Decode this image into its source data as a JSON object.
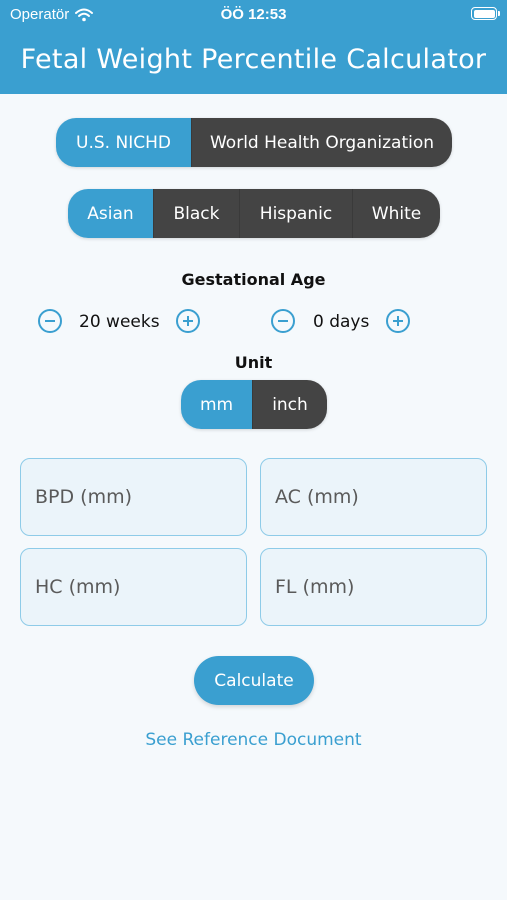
{
  "status_bar": {
    "carrier": "Operatör",
    "time": "ÖÖ 12:53",
    "wifi_icon": "wifi-icon",
    "battery_icon": "battery-icon"
  },
  "header": {
    "title": "Fetal Weight Percentile Calculator"
  },
  "standard": {
    "options": [
      "U.S. NICHD",
      "World Health Organization"
    ],
    "selected": "U.S. NICHD"
  },
  "ethnicity": {
    "options": [
      "Asian",
      "Black",
      "Hispanic",
      "White"
    ],
    "selected": "Asian"
  },
  "gestational_age": {
    "label": "Gestational Age",
    "weeks_value": "20 weeks",
    "days_value": "0 days",
    "minus_icon": "minus-circle-icon",
    "plus_icon": "plus-circle-icon"
  },
  "unit": {
    "label": "Unit",
    "options": [
      "mm",
      "inch"
    ],
    "selected": "mm"
  },
  "fields": {
    "bpd_placeholder": "BPD (mm)",
    "ac_placeholder": "AC (mm)",
    "hc_placeholder": "HC (mm)",
    "fl_placeholder": "FL (mm)"
  },
  "actions": {
    "calculate_label": "Calculate",
    "reference_link": "See Reference Document"
  },
  "colors": {
    "accent": "#3a9fd0",
    "segment_inactive": "#444444",
    "background": "#f5f9fc"
  }
}
